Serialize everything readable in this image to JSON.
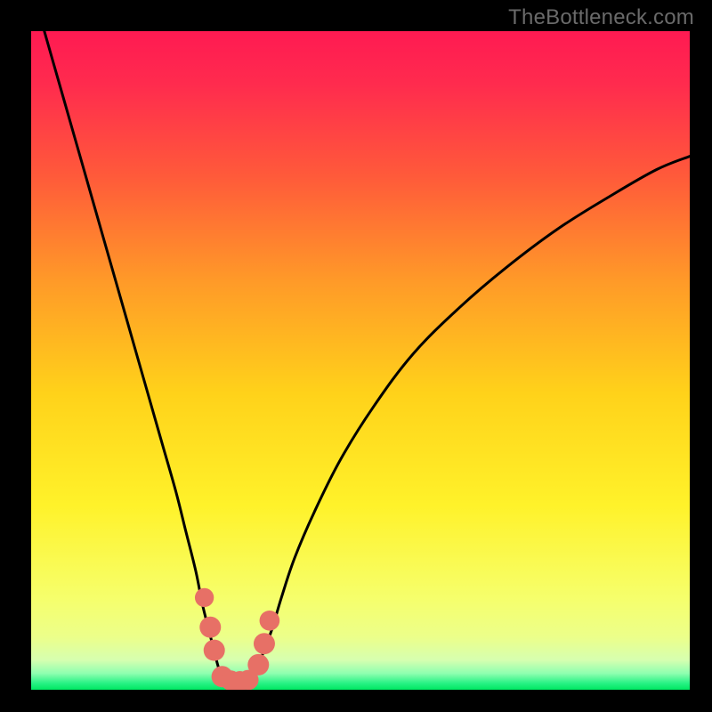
{
  "watermark": "TheBottleneck.com",
  "colors": {
    "page_bg": "#000000",
    "gradient_top": "#ff1a52",
    "gradient_mid1": "#ff7a2a",
    "gradient_mid2": "#ffe415",
    "gradient_low": "#f6ff6b",
    "gradient_band": "#f0ff90",
    "gradient_bottom": "#00e862",
    "curve_stroke": "#000000",
    "marker_fill": "#e77066",
    "watermark_text": "#6a6a6a"
  },
  "chart_data": {
    "type": "line",
    "title": "",
    "xlabel": "",
    "ylabel": "",
    "xlim": [
      0,
      100
    ],
    "ylim": [
      0,
      100
    ],
    "series": [
      {
        "name": "left-branch",
        "x": [
          2,
          4,
          6,
          8,
          10,
          12,
          14,
          16,
          18,
          20,
          22,
          23.5,
          25,
          26,
          27,
          28,
          28.8
        ],
        "values": [
          100,
          93,
          86,
          79,
          72,
          65,
          58,
          51,
          44,
          37,
          30,
          24,
          18,
          13,
          9,
          5,
          2
        ]
      },
      {
        "name": "right-branch",
        "x": [
          34,
          35,
          36.5,
          38,
          40,
          43,
          47,
          52,
          58,
          65,
          72,
          80,
          88,
          95,
          100
        ],
        "values": [
          2,
          5,
          9,
          14,
          20,
          27,
          35,
          43,
          51,
          58,
          64,
          70,
          75,
          79,
          81
        ]
      },
      {
        "name": "valley-floor",
        "x": [
          28.8,
          30,
          31.5,
          33,
          34
        ],
        "values": [
          1.5,
          1.2,
          1.1,
          1.2,
          1.5
        ]
      }
    ],
    "markers": [
      {
        "x": 26.3,
        "y": 14.0,
        "r": 1.0
      },
      {
        "x": 27.2,
        "y": 9.5,
        "r": 1.2
      },
      {
        "x": 27.8,
        "y": 6.0,
        "r": 1.2
      },
      {
        "x": 29.0,
        "y": 2.0,
        "r": 1.2
      },
      {
        "x": 30.3,
        "y": 1.4,
        "r": 1.1
      },
      {
        "x": 31.7,
        "y": 1.3,
        "r": 1.1
      },
      {
        "x": 33.0,
        "y": 1.5,
        "r": 1.1
      },
      {
        "x": 34.5,
        "y": 3.8,
        "r": 1.2
      },
      {
        "x": 35.4,
        "y": 7.0,
        "r": 1.2
      },
      {
        "x": 36.2,
        "y": 10.5,
        "r": 1.1
      }
    ],
    "gradient_stops": [
      {
        "offset": 0.0,
        "color": "#ff1a52"
      },
      {
        "offset": 0.08,
        "color": "#ff2b4e"
      },
      {
        "offset": 0.22,
        "color": "#ff5a3a"
      },
      {
        "offset": 0.38,
        "color": "#ff9a28"
      },
      {
        "offset": 0.55,
        "color": "#ffd21a"
      },
      {
        "offset": 0.72,
        "color": "#fff22a"
      },
      {
        "offset": 0.86,
        "color": "#f6ff6b"
      },
      {
        "offset": 0.92,
        "color": "#ecff8a"
      },
      {
        "offset": 0.955,
        "color": "#d6ffb0"
      },
      {
        "offset": 0.975,
        "color": "#8fffb0"
      },
      {
        "offset": 0.99,
        "color": "#28f285"
      },
      {
        "offset": 1.0,
        "color": "#00e862"
      }
    ]
  }
}
